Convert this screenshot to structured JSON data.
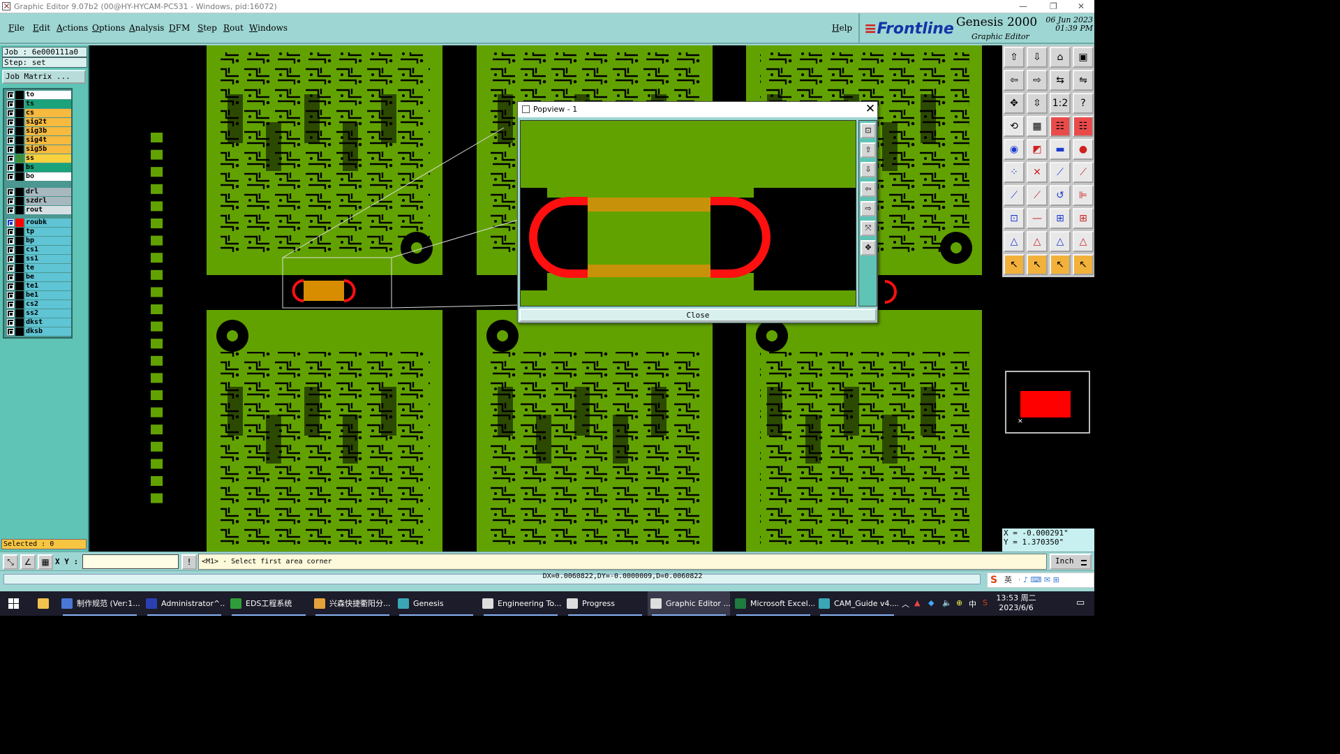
{
  "window": {
    "title": "Graphic Editor 9.07b2 (00@HY-HYCAM-PC531 - Windows, pid:16072)",
    "minimize": "—",
    "restore": "❐",
    "close": "✕"
  },
  "menu": {
    "items": [
      "File",
      "Edit",
      "Actions",
      "Options",
      "Analysis",
      "DFM",
      "Step",
      "Rout",
      "Windows"
    ],
    "help": "Help"
  },
  "brand": {
    "logo_main": "Frontline",
    "app_title": "Genesis 2000",
    "app_subtitle": "Graphic Editor",
    "date": "06 Jun 2023",
    "time": "01:39 PM"
  },
  "job": {
    "job_label": "Job : 6e000111a0",
    "step_label": "Step: set",
    "job_matrix_button": "Job Matrix ..."
  },
  "layers": [
    {
      "name": "to",
      "color": "#ffffff",
      "swatch": "#000000"
    },
    {
      "name": "ts",
      "color": "#1aa37a",
      "swatch": "#000000"
    },
    {
      "name": "cs",
      "color": "#f7b93e",
      "swatch": "#000000"
    },
    {
      "name": "sig2t",
      "color": "#f7b93e",
      "swatch": "#000000"
    },
    {
      "name": "sig3b",
      "color": "#f7b93e",
      "swatch": "#000000"
    },
    {
      "name": "sig4t",
      "color": "#f7b93e",
      "swatch": "#000000"
    },
    {
      "name": "sig5b",
      "color": "#f7b93e",
      "swatch": "#000000"
    },
    {
      "name": "ss",
      "color": "#f7d13e",
      "swatch": "#3a8d3a"
    },
    {
      "name": "bs",
      "color": "#1aa37a",
      "swatch": "#000000"
    },
    {
      "name": "bo",
      "color": "#ffffff",
      "swatch": "#000000"
    },
    {
      "name": "drl",
      "color": "#a7b8be",
      "swatch": "#000000"
    },
    {
      "name": "szdrl",
      "color": "#a7b8be",
      "swatch": "#000000"
    },
    {
      "name": "rout",
      "color": "#d6e0e2",
      "swatch": "#000000"
    },
    {
      "name": "roubk",
      "color": "#5fc4d4",
      "swatch": "#ff0000",
      "active": true
    },
    {
      "name": "tp",
      "color": "#5fc4d4",
      "swatch": "#000000"
    },
    {
      "name": "bp",
      "color": "#5fc4d4",
      "swatch": "#000000"
    },
    {
      "name": "cs1",
      "color": "#5fc4d4",
      "swatch": "#000000"
    },
    {
      "name": "ss1",
      "color": "#5fc4d4",
      "swatch": "#000000"
    },
    {
      "name": "te",
      "color": "#5fc4d4",
      "swatch": "#000000"
    },
    {
      "name": "be",
      "color": "#5fc4d4",
      "swatch": "#000000"
    },
    {
      "name": "te1",
      "color": "#5fc4d4",
      "swatch": "#000000"
    },
    {
      "name": "be1",
      "color": "#5fc4d4",
      "swatch": "#000000"
    },
    {
      "name": "cs2",
      "color": "#5fc4d4",
      "swatch": "#000000"
    },
    {
      "name": "ss2",
      "color": "#5fc4d4",
      "swatch": "#000000"
    },
    {
      "name": "dkst",
      "color": "#5fc4d4",
      "swatch": "#000000"
    },
    {
      "name": "dksb",
      "color": "#5fc4d4",
      "swatch": "#000000"
    }
  ],
  "status": {
    "selected": "Selected : 0",
    "xy_label": "X Y :",
    "xy_value": "",
    "prompt": "<M1> - Select first area corner",
    "units": "Inch",
    "measure": "DX=0.0060822,DY=-0.0000009,D=0.0060822",
    "coord_x": "X = -0.000291\"",
    "coord_y": "Y =  1.370350\""
  },
  "popview": {
    "title": "Popview - 1",
    "close_label": "Close",
    "close_x": "✕"
  },
  "colors": {
    "board_green": "#62a200",
    "rout_red": "#ff1010",
    "slot_orange": "#d88c00",
    "panel_teal": "#9ed6d3",
    "layer_panel": "#5fc4b6"
  },
  "taskbar": {
    "items": [
      {
        "label": "制作规范 (Ver:1...",
        "icon": "doc-icon",
        "color": "#4a78d6"
      },
      {
        "label": "Administrator^...",
        "icon": "app-icon",
        "color": "#2b3fb0"
      },
      {
        "label": "EDS工程系统",
        "icon": "eds-icon",
        "color": "#2f9e3a"
      },
      {
        "label": "兴森快捷衢阳分...",
        "icon": "browser-icon",
        "color": "#e5a23a"
      },
      {
        "label": "Genesis",
        "icon": "genesis-icon",
        "color": "#3aa6b5"
      },
      {
        "label": "Engineering To...",
        "icon": "engineering-icon",
        "color": "#dddddd"
      },
      {
        "label": "Progress",
        "icon": "progress-icon",
        "color": "#dddddd"
      },
      {
        "label": "Graphic Editor ...",
        "icon": "graphic-editor-icon",
        "color": "#dddddd",
        "active": true
      },
      {
        "label": "Microsoft Excel...",
        "icon": "excel-icon",
        "color": "#1f7a3f"
      },
      {
        "label": "CAM_Guide v4....",
        "icon": "cam-icon",
        "color": "#3aa6b5"
      }
    ],
    "clock_time": "13:53 周二",
    "clock_date": "2023/6/6",
    "ime": "英",
    "lang": "中"
  }
}
